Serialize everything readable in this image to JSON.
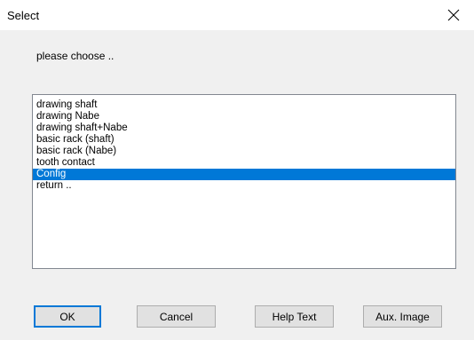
{
  "window": {
    "title": "Select"
  },
  "prompt": "please choose ..",
  "list": {
    "items": [
      "drawing shaft",
      "drawing Nabe",
      "drawing shaft+Nabe",
      "basic rack (shaft)",
      "basic rack (Nabe)",
      "tooth contact",
      "Config",
      "return .."
    ],
    "selected_index": 6
  },
  "buttons": {
    "ok": "OK",
    "cancel": "Cancel",
    "help": "Help Text",
    "aux": "Aux. Image"
  },
  "colors": {
    "selection": "#0078d7",
    "default_button_border": "#0078d7"
  },
  "icons": {
    "close": "close-icon"
  }
}
